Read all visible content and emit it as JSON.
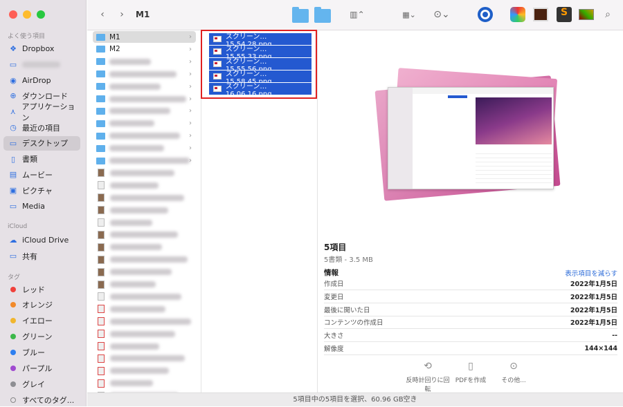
{
  "window": {
    "title": "M1"
  },
  "sidebar": {
    "favorites_header": "よく使う項目",
    "favorites": [
      {
        "label": "Dropbox",
        "icon": "dropbox-icon"
      },
      {
        "label": "",
        "icon": "folder-icon"
      },
      {
        "label": "AirDrop",
        "icon": "airdrop-icon"
      },
      {
        "label": "ダウンロード",
        "icon": "download-icon"
      },
      {
        "label": "アプリケーション",
        "icon": "applications-icon"
      },
      {
        "label": "最近の項目",
        "icon": "clock-icon"
      },
      {
        "label": "デスクトップ",
        "icon": "desktop-icon"
      },
      {
        "label": "書類",
        "icon": "document-icon"
      },
      {
        "label": "ムービー",
        "icon": "film-icon"
      },
      {
        "label": "ピクチャ",
        "icon": "photo-icon"
      },
      {
        "label": "Media",
        "icon": "folder-icon"
      }
    ],
    "icloud_header": "iCloud",
    "icloud": [
      {
        "label": "iCloud Drive",
        "icon": "cloud-icon"
      },
      {
        "label": "共有",
        "icon": "shared-folder-icon"
      }
    ],
    "tags_header": "タグ",
    "tags": [
      {
        "label": "レッド",
        "color": "#f0413c"
      },
      {
        "label": "オレンジ",
        "color": "#f28a2a"
      },
      {
        "label": "イエロー",
        "color": "#f1b62e"
      },
      {
        "label": "グリーン",
        "color": "#3cb84a"
      },
      {
        "label": "ブルー",
        "color": "#2f7ff0"
      },
      {
        "label": "パープル",
        "color": "#a04ad0"
      },
      {
        "label": "グレイ",
        "color": "#8e8e93"
      },
      {
        "label": "すべてのタグ...",
        "color": ""
      }
    ]
  },
  "column1": {
    "items": [
      {
        "label": "M1",
        "kind": "folder"
      },
      {
        "label": "M2",
        "kind": "folder"
      }
    ],
    "blurred_kinds": [
      "folder",
      "folder",
      "folder",
      "folder",
      "folder",
      "folder",
      "folder",
      "folder",
      "folder",
      "image",
      "doc",
      "image",
      "image",
      "doc",
      "image",
      "image",
      "image",
      "image",
      "image",
      "doc",
      "pdf",
      "pdf",
      "pdf",
      "pdf",
      "pdf",
      "pdf",
      "pdf",
      "image"
    ]
  },
  "column2": {
    "items": [
      "スクリーン…15.54.28.png",
      "スクリーン…15.55.33.png",
      "スクリーン…15.55.56.png",
      "スクリーン…15.58.45.png",
      "スクリーン…16.06.16.png"
    ]
  },
  "preview": {
    "title": "5項目",
    "subtitle": "5書類 - 3.5 MB",
    "info_header": "情報",
    "show_less": "表示項目を減らす",
    "rows": [
      {
        "key": "作成日",
        "value": "2022年1月5日"
      },
      {
        "key": "変更日",
        "value": "2022年1月5日"
      },
      {
        "key": "最後に開いた日",
        "value": "2022年1月5日"
      },
      {
        "key": "コンテンツの作成日",
        "value": "2022年1月5日"
      },
      {
        "key": "大きさ",
        "value": "--"
      },
      {
        "key": "解像度",
        "value": "144×144"
      }
    ],
    "actions": [
      {
        "label": "反時計回りに回転",
        "icon": "rotate-left-icon"
      },
      {
        "label": "PDFを作成",
        "icon": "pdf-icon"
      },
      {
        "label": "その他...",
        "icon": "more-icon"
      }
    ]
  },
  "status": "5項目中の5項目を選択、60.96 GB空き"
}
